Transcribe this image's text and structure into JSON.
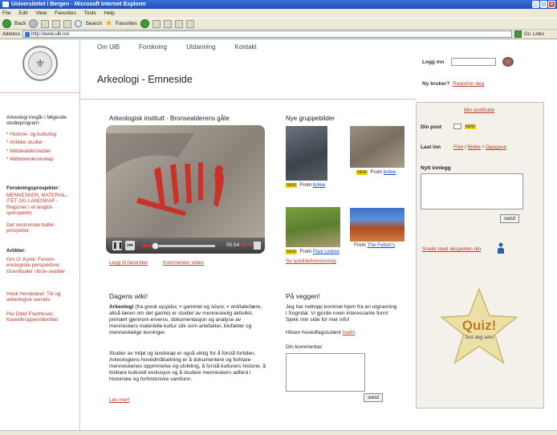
{
  "browser": {
    "title": "Universitetet i Bergen - Microsoft Internet Explorer",
    "menu": [
      "File",
      "Edit",
      "View",
      "Favorites",
      "Tools",
      "Help"
    ],
    "toolbar": {
      "back": "Back",
      "search": "Search",
      "favorites": "Favorites"
    },
    "address_label": "Address",
    "address_value": "http://www.uib.no/",
    "go_label": "Go",
    "links_label": "Links"
  },
  "nav": {
    "items": [
      "Om UiB",
      "Forskning",
      "Utdanning",
      "Kontakt"
    ]
  },
  "page_title": "Arkeologi - Emneside",
  "login": {
    "label": "Logg inn",
    "new_user": "Ny bruker?",
    "register": "Registrer deg"
  },
  "left": {
    "intro": "Arkeologi inngår i følgende studieprogram:",
    "programs": [
      "* Historie- og kulturfag",
      "* Antikke studier",
      "* Middelalderstudier",
      "* Midtøstenkunnskap"
    ],
    "research_heading": "Forskningsprosjekter:",
    "research_text": "MENNESKER, MATERIAL-ITET OG LANDSKAP - Regioner i et langtid-sperspektiv",
    "research_text2": "Det vestnorske haller-prosjektet",
    "articles_heading": "Artikler:",
    "articles": [
      "Gro O. Kyvik: Fenom-enologiske perspektiver: Gravritualer i bron-sealder",
      "Heidi Hendeland: Tid og arkeologisk narrativ",
      "Per Ditlef Fredriksen: Kaset/kroppen/identitet"
    ]
  },
  "video": {
    "heading": "Arkeologisk institutt - Bronsealderens gåte",
    "time_current": "00:54",
    "time_total": "03:00",
    "add_favorite": "Legg til favoritter",
    "comment_video": "Kommenter video"
  },
  "photos": {
    "heading": "Nye gruppebilder",
    "items": [
      {
        "new": "NEW",
        "from": "From",
        "user": "bolee"
      },
      {
        "new": "NEW",
        "from": "From",
        "user": "bolee"
      },
      {
        "new": "NEW",
        "from": "From",
        "user": "Paul Lisboa"
      },
      {
        "new": "",
        "from": "From",
        "user": "The Futton's"
      }
    ],
    "slideshow": "Se lysbildefremvisning"
  },
  "wiki": {
    "heading": "Dagens wiki!",
    "term": "Arkeologi",
    "p1": " (fra gresk αρχαίος = gammel og λόγος = ord/tale/lære, altså læren om det gamle) er studiet av menneskelig aktivitet, primært gjennom ervervs, dokumentasjon og analyse av menneskers materielle kultur slik som artefakter, biofakter og menneskelige levninger.",
    "p2": "Studier av miljø og landskap er også viktig for å forstå fortiden. Arkeologiens hovedmålsetning er å dokumentere og forklare menneskenes opprinnelse og utvikling, å forstå kulturers historie, å forklare kulturell evolusjon og å studere menneskers adferd i historiske og forhistoriske samfunn.",
    "read_more": "Les mer!"
  },
  "onwall": {
    "heading": "På veggen!",
    "text": "Jeg har nettopp kommet hjem fra en utgravning i Sogndal. Vi gjorde noen interessante funn! Sjekk min side for mer info!",
    "greeting": "Hilsen hovedfagstudent",
    "author": "Iselin",
    "comment_label": "Din kommentar:",
    "send": "send"
  },
  "profile": {
    "my_profile": "Min profilside",
    "your_mail": "Din post",
    "mail_new": "NEW",
    "uploaded": "Last inn",
    "upload_links": [
      "Film",
      "Bilder",
      "Oppgave"
    ],
    "new_post": "Nytt innlegg",
    "send": "send",
    "chat": "Snakk med eksperten din"
  },
  "quiz": {
    "title": "Quiz!",
    "subtitle": "Test deg selv!"
  }
}
